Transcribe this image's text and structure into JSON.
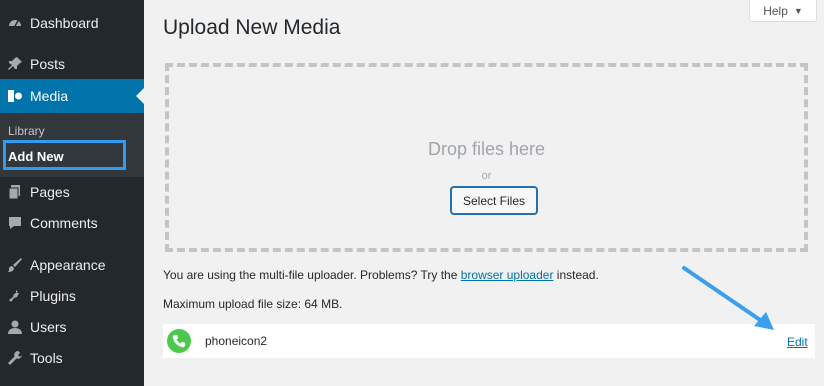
{
  "sidebar": {
    "items": [
      {
        "label": "Dashboard",
        "icon": "dashboard-icon"
      },
      {
        "label": "Posts",
        "icon": "pin-icon"
      },
      {
        "label": "Media",
        "icon": "media-icon"
      },
      {
        "label": "Pages",
        "icon": "pages-icon"
      },
      {
        "label": "Comments",
        "icon": "comments-icon"
      },
      {
        "label": "Appearance",
        "icon": "brush-icon"
      },
      {
        "label": "Plugins",
        "icon": "plugin-icon"
      },
      {
        "label": "Users",
        "icon": "user-icon"
      },
      {
        "label": "Tools",
        "icon": "wrench-icon"
      }
    ],
    "submenu": {
      "library": "Library",
      "add_new": "Add New"
    }
  },
  "header": {
    "help_label": "Help"
  },
  "main": {
    "title": "Upload New Media",
    "drop_zone": {
      "drop_text": "Drop files here",
      "or_text": "or",
      "select_button": "Select Files"
    },
    "uploader_note_prefix": "You are using the multi-file uploader. Problems? Try the ",
    "uploader_note_link": "browser uploader",
    "uploader_note_suffix": " instead.",
    "max_upload": "Maximum upload file size: 64 MB.",
    "file": {
      "name": "phoneicon2",
      "edit_label": "Edit"
    }
  },
  "colors": {
    "sidebar_bg": "#23282d",
    "accent": "#0073aa",
    "highlight": "#2f9cf2",
    "thumb": "#4cc94c"
  }
}
